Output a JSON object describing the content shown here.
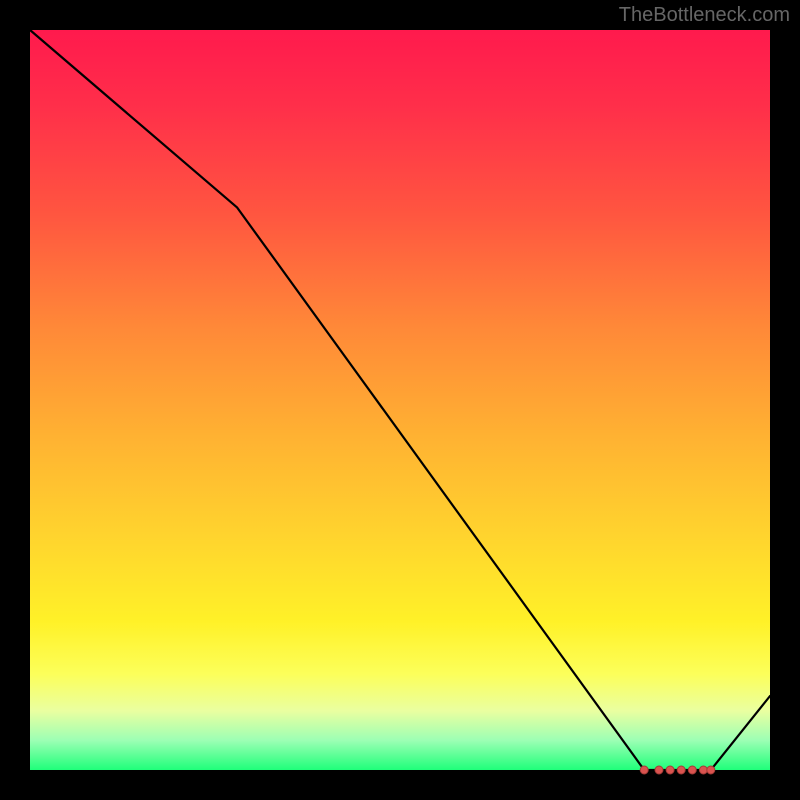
{
  "attribution": "TheBottleneck.com",
  "chart_data": {
    "type": "line",
    "title": "",
    "xlabel": "",
    "ylabel": "",
    "xlim": [
      0,
      100
    ],
    "ylim": [
      0,
      100
    ],
    "x": [
      0,
      28,
      83,
      92,
      100
    ],
    "y": [
      100,
      76,
      0,
      0,
      10
    ],
    "highlight_range_x": [
      83,
      92
    ],
    "highlight_y": 0,
    "highlight_dots_x": [
      83,
      85,
      86.5,
      88,
      89.5,
      91,
      92
    ],
    "gradient_stops": [
      {
        "pos": 0,
        "color": "#ff1a4d"
      },
      {
        "pos": 25,
        "color": "#ff5640"
      },
      {
        "pos": 55,
        "color": "#ffb232"
      },
      {
        "pos": 80,
        "color": "#fff128"
      },
      {
        "pos": 92,
        "color": "#eaffa0"
      },
      {
        "pos": 100,
        "color": "#1fff7a"
      }
    ]
  }
}
